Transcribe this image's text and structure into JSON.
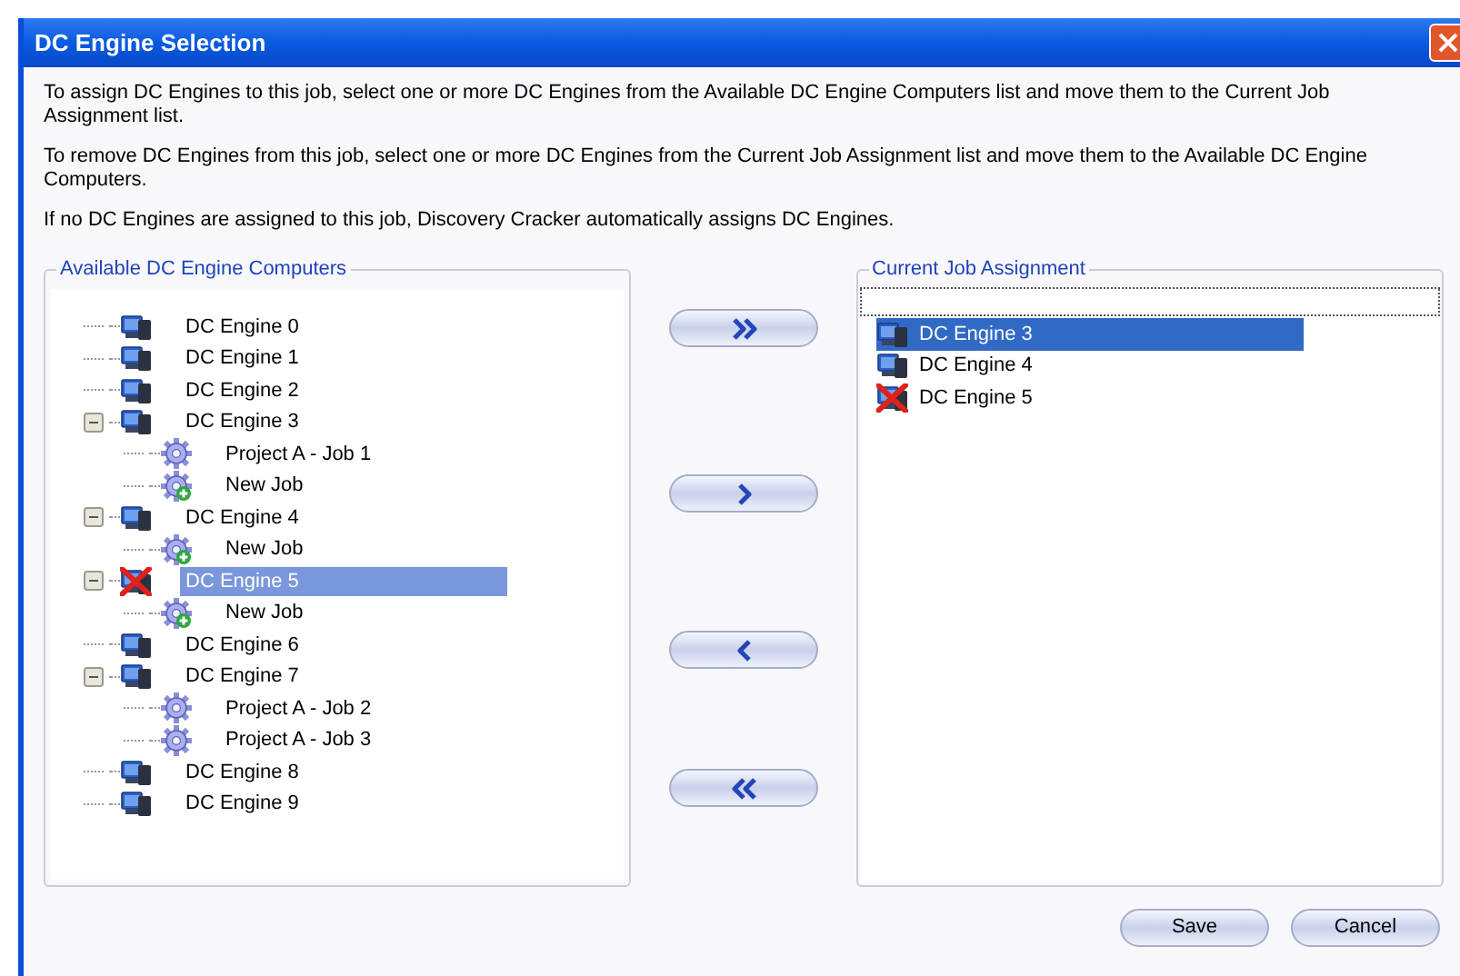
{
  "window": {
    "title": "DC Engine Selection"
  },
  "instructions": [
    "To assign DC Engines to this job, select one or more DC Engines from the Available DC Engine Computers list and move them to the Current Job Assignment list.",
    "To remove DC Engines from this job, select one or more DC Engines from the Current Job Assignment list and move them to the Available DC Engine Computers.",
    "If no DC Engines are assigned to this job, Discovery Cracker automatically assigns DC Engines."
  ],
  "available": {
    "title": "Available DC Engine Computers",
    "items": [
      {
        "label": "DC Engine 0",
        "kind": "computer",
        "selected": false
      },
      {
        "label": "DC Engine 1",
        "kind": "computer",
        "selected": false
      },
      {
        "label": "DC Engine 2",
        "kind": "computer",
        "selected": false
      },
      {
        "label": "DC Engine 3",
        "kind": "computer",
        "selected": false,
        "expanded": true,
        "children": [
          {
            "label": "Project A - Job 1",
            "kind": "job",
            "selected": false
          },
          {
            "label": "New Job",
            "kind": "new_job",
            "selected": false
          }
        ]
      },
      {
        "label": "DC Engine 4",
        "kind": "computer",
        "selected": false,
        "expanded": true,
        "children": [
          {
            "label": "New Job",
            "kind": "new_job",
            "selected": false
          }
        ]
      },
      {
        "label": "DC Engine 5",
        "kind": "offline",
        "selected": true,
        "expanded": true,
        "children": [
          {
            "label": "New Job",
            "kind": "new_job",
            "selected": false
          }
        ]
      },
      {
        "label": "DC Engine 6",
        "kind": "computer",
        "selected": false
      },
      {
        "label": "DC Engine 7",
        "kind": "computer",
        "selected": false,
        "expanded": true,
        "children": [
          {
            "label": "Project A - Job 2",
            "kind": "job",
            "selected": false
          },
          {
            "label": "Project A - Job 3",
            "kind": "job",
            "selected": false
          }
        ]
      },
      {
        "label": "DC Engine 8",
        "kind": "computer",
        "selected": false
      },
      {
        "label": "DC Engine 9",
        "kind": "computer",
        "selected": false
      }
    ]
  },
  "move_buttons": [
    {
      "kind": "add_all"
    },
    {
      "kind": "add"
    },
    {
      "kind": "remove"
    },
    {
      "kind": "remove_all"
    }
  ],
  "assignment": {
    "title": "Current Job Assignment",
    "items": [
      {
        "label": "DC Engine 3",
        "kind": "computer",
        "selected": true
      },
      {
        "label": "DC Engine 4",
        "kind": "computer",
        "selected": false
      },
      {
        "label": "DC Engine 5",
        "kind": "offline",
        "selected": false
      }
    ]
  },
  "buttons": [
    "Save",
    "Cancel"
  ]
}
